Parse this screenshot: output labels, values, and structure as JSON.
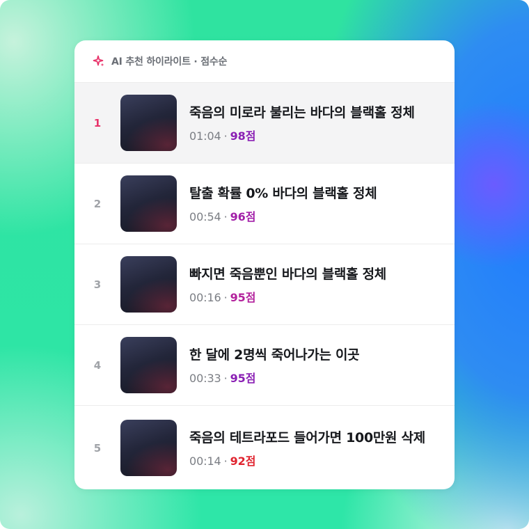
{
  "header": {
    "icon": "sparkle-icon",
    "icon_color": "#e8336a",
    "title": "AI 추천 하이라이트 · 점수순"
  },
  "items": [
    {
      "rank": "1",
      "title": "죽음의 미로라 불리는 바다의 블랙홀 정체",
      "time": "01:04",
      "score": "98점",
      "score_color": "#8a1fb4",
      "active": true
    },
    {
      "rank": "2",
      "title": "탈출 확률 0% 바다의 블랙홀 정체",
      "time": "00:54",
      "score": "96점",
      "score_color": "#a21fa8",
      "active": false
    },
    {
      "rank": "3",
      "title": "빠지면 죽음뿐인 바다의 블랙홀 정체",
      "time": "00:16",
      "score": "95점",
      "score_color": "#b3219c",
      "active": false
    },
    {
      "rank": "4",
      "title": "한 달에 2명씩 죽어나가는 이곳",
      "time": "00:33",
      "score": "95점",
      "score_color": "#8a1fb4",
      "active": false
    },
    {
      "rank": "5",
      "title": "죽음의 테트라포드 들어가면 100만원 삭제",
      "time": "00:14",
      "score": "92점",
      "score_color": "#e0242f",
      "active": false
    }
  ],
  "colors": {
    "active_rank": "#e8336a",
    "accent_pink": "#e8336a"
  }
}
